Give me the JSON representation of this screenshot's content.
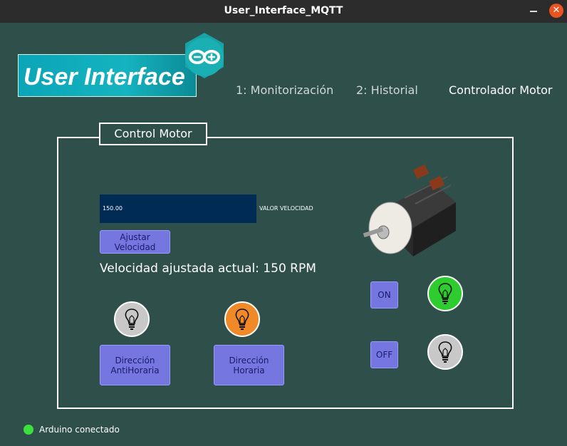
{
  "window": {
    "title": "User_Interface_MQTT"
  },
  "header": {
    "logo_text": "User Interface"
  },
  "tabs": [
    {
      "label": "1: Monitorización"
    },
    {
      "label": "2: Historial"
    },
    {
      "label": "Controlador Motor"
    }
  ],
  "panel": {
    "title": "Control Motor",
    "speed_value": "150.00",
    "speed_label": "VALOR VELOCIDAD",
    "adjust_button": "Ajustar\nVelocidad",
    "current_speed_text": "Velocidad ajustada actual: 150 RPM",
    "ccw_button": "Dirección\nAntiHoraria",
    "cw_button": "Dirección\nHoraria",
    "on_button": "ON",
    "off_button": "OFF"
  },
  "indicators": {
    "ccw_color": "#c8c8c8",
    "cw_color": "#f08a28",
    "on_color": "#2ecc2e",
    "off_color": "#c8c8c8"
  },
  "status": {
    "text": "Arduino conectado",
    "color": "#3ce03c"
  }
}
